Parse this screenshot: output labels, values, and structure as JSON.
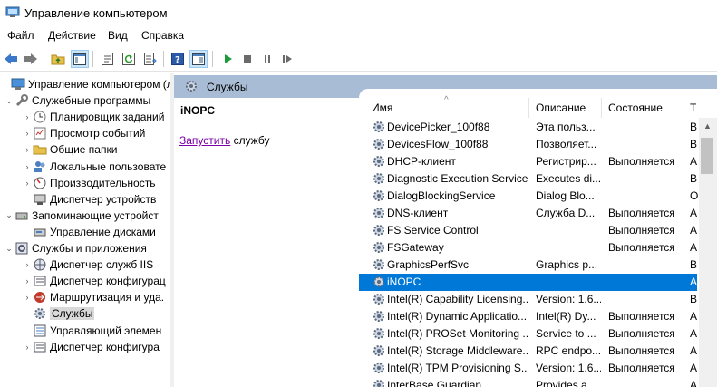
{
  "window": {
    "title": "Управление компьютером"
  },
  "menu": [
    "Файл",
    "Действие",
    "Вид",
    "Справка"
  ],
  "tree": [
    {
      "label": "Управление компьютером (л",
      "level": 0,
      "expander": "",
      "icon": "computer-icon"
    },
    {
      "label": "Служебные программы",
      "level": 1,
      "expander": "expanded",
      "icon": "tools-icon"
    },
    {
      "label": "Планировщик заданий",
      "level": 2,
      "expander": "collapsed",
      "icon": "clock-icon"
    },
    {
      "label": "Просмотр событий",
      "level": 2,
      "expander": "collapsed",
      "icon": "event-viewer-icon"
    },
    {
      "label": "Общие папки",
      "level": 2,
      "expander": "collapsed",
      "icon": "shared-folder-icon"
    },
    {
      "label": "Локальные пользовате",
      "level": 2,
      "expander": "collapsed",
      "icon": "users-icon"
    },
    {
      "label": "Производительность",
      "level": 2,
      "expander": "collapsed",
      "icon": "performance-icon"
    },
    {
      "label": "Диспетчер устройств",
      "level": 2,
      "expander": "",
      "icon": "device-manager-icon"
    },
    {
      "label": "Запоминающие устройст",
      "level": 1,
      "expander": "expanded",
      "icon": "storage-icon"
    },
    {
      "label": "Управление дисками",
      "level": 2,
      "expander": "",
      "icon": "disk-icon"
    },
    {
      "label": "Службы и приложения",
      "level": 1,
      "expander": "expanded",
      "icon": "services-apps-icon"
    },
    {
      "label": "Диспетчер служб IIS",
      "level": 2,
      "expander": "collapsed",
      "icon": "iis-icon"
    },
    {
      "label": "Диспетчер конфигурац",
      "level": 2,
      "expander": "collapsed",
      "icon": "config-manager-icon"
    },
    {
      "label": "Маршрутизация и уда.",
      "level": 2,
      "expander": "collapsed",
      "icon": "routing-icon"
    },
    {
      "label": "Службы",
      "level": 2,
      "expander": "",
      "icon": "gear-icon",
      "selected": true
    },
    {
      "label": "Управляющий элемен",
      "level": 2,
      "expander": "",
      "icon": "wmi-icon"
    },
    {
      "label": "Диспетчер конфигура",
      "level": 2,
      "expander": "collapsed",
      "icon": "config-manager-icon"
    }
  ],
  "services_header": {
    "label": "Службы"
  },
  "description_pane": {
    "service_name": "iNOPC",
    "start_link": "Запустить",
    "start_suffix": " службу"
  },
  "columns": {
    "name": "Имя",
    "description": "Описание",
    "status": "Состояние",
    "startup": "Т"
  },
  "rows": [
    {
      "name": "DevicePicker_100f88",
      "description": "Эта польз...",
      "status": "",
      "startup": "В"
    },
    {
      "name": "DevicesFlow_100f88",
      "description": "Позволяет...",
      "status": "",
      "startup": "В"
    },
    {
      "name": "DHCP-клиент",
      "description": "Регистрир...",
      "status": "Выполняется",
      "startup": "А"
    },
    {
      "name": "Diagnostic Execution Service",
      "description": "Executes di...",
      "status": "",
      "startup": "В"
    },
    {
      "name": "DialogBlockingService",
      "description": "Dialog Blo...",
      "status": "",
      "startup": "О"
    },
    {
      "name": "DNS-клиент",
      "description": "Служба D...",
      "status": "Выполняется",
      "startup": "А"
    },
    {
      "name": "FS Service Control",
      "description": "",
      "status": "Выполняется",
      "startup": "А"
    },
    {
      "name": "FSGateway",
      "description": "",
      "status": "Выполняется",
      "startup": "А"
    },
    {
      "name": "GraphicsPerfSvc",
      "description": "Graphics p...",
      "status": "",
      "startup": "В"
    },
    {
      "name": "iNOPC",
      "description": "",
      "status": "",
      "startup": "А",
      "selected": true
    },
    {
      "name": "Intel(R) Capability Licensing...",
      "description": "Version: 1.6...",
      "status": "",
      "startup": "В"
    },
    {
      "name": "Intel(R) Dynamic Applicatio...",
      "description": "Intel(R) Dy...",
      "status": "Выполняется",
      "startup": "А"
    },
    {
      "name": "Intel(R) PROSet Monitoring ...",
      "description": "Service to ...",
      "status": "Выполняется",
      "startup": "А"
    },
    {
      "name": "Intel(R) Storage Middleware...",
      "description": "RPC endpo...",
      "status": "Выполняется",
      "startup": "А"
    },
    {
      "name": "Intel(R) TPM Provisioning S...",
      "description": "Version: 1.6...",
      "status": "Выполняется",
      "startup": "А"
    },
    {
      "name": "InterBase Guardian",
      "description": "Provides a ...",
      "status": "",
      "startup": "А"
    }
  ],
  "colors": {
    "selection": "#0078d7",
    "header_band": "#a9bcd5",
    "link": "#7a00a6"
  }
}
